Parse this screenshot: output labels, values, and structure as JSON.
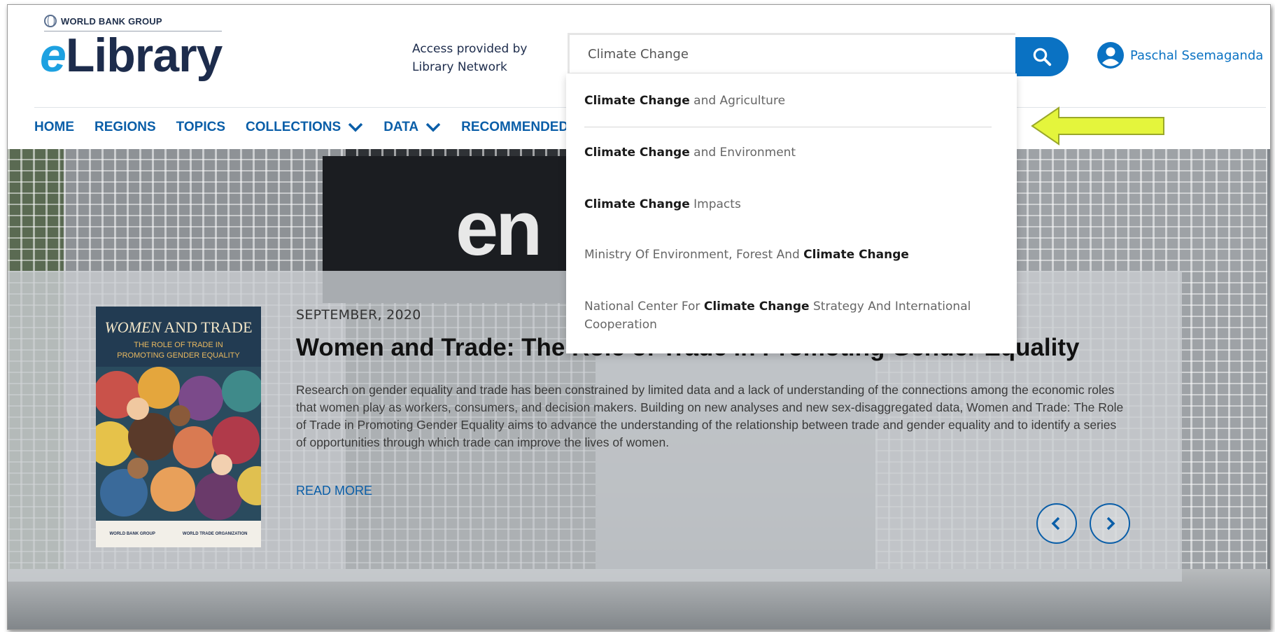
{
  "header": {
    "org_name": "WORLD BANK GROUP",
    "logo_prefix": "e",
    "logo_text": "Library",
    "access_line1": "Access provided by",
    "access_line2": "Library Network"
  },
  "search": {
    "value": "Climate Change",
    "button_icon": "search-icon"
  },
  "user": {
    "name": "Paschal Ssemaganda",
    "icon": "user-circle-icon"
  },
  "nav": {
    "items": [
      {
        "label": "HOME"
      },
      {
        "label": "REGIONS"
      },
      {
        "label": "TOPICS"
      },
      {
        "label": "COLLECTIONS",
        "icon": "chevron-down-icon"
      },
      {
        "label": "DATA",
        "icon": "chevron-down-icon"
      },
      {
        "label": "RECOMMENDED I"
      }
    ]
  },
  "suggestions": [
    {
      "pre": "",
      "bold": "Climate Change",
      "post": " and Agriculture"
    },
    {
      "pre": "",
      "bold": "Climate Change",
      "post": " and Environment"
    },
    {
      "pre": "",
      "bold": "Climate Change",
      "post": " Impacts"
    },
    {
      "pre": "Ministry Of Environment, Forest And ",
      "bold": "Climate Change",
      "post": ""
    },
    {
      "pre": "National Center For ",
      "bold": "Climate Change",
      "post": " Strategy And International Cooperation"
    }
  ],
  "hero": {
    "background_text": "en",
    "cover": {
      "title_italic": "WOMEN",
      "title_rest": " AND TRADE",
      "subtitle_line1": "THE ROLE OF TRADE IN",
      "subtitle_line2": "PROMOTING GENDER EQUALITY",
      "footer_left": "WORLD BANK GROUP",
      "footer_right": "WORLD TRADE ORGANIZATION"
    },
    "date": "SEPTEMBER, 2020",
    "title": "Women and Trade: The Role of Trade in Promoting Gender Equality",
    "description": "Research on gender equality and trade has been constrained by limited data and a lack of understanding of the connections among the economic roles that women play as workers, consumers, and decision makers. Building on new analyses and new sex-disaggregated data, Women and Trade: The Role of Trade in Promoting Gender Equality aims to advance the understanding of the relationship between trade and gender equality and to identify a series of opportunities through which trade can improve the lives of women.",
    "read_more": "READ MORE",
    "prev_icon": "chevron-left-icon",
    "next_icon": "chevron-right-icon"
  },
  "colors": {
    "accent_blue": "#0a72c3",
    "nav_blue": "#0a5ea8",
    "logo_navy": "#1d2c4c",
    "annotation_arrow": "#e4f53c"
  }
}
